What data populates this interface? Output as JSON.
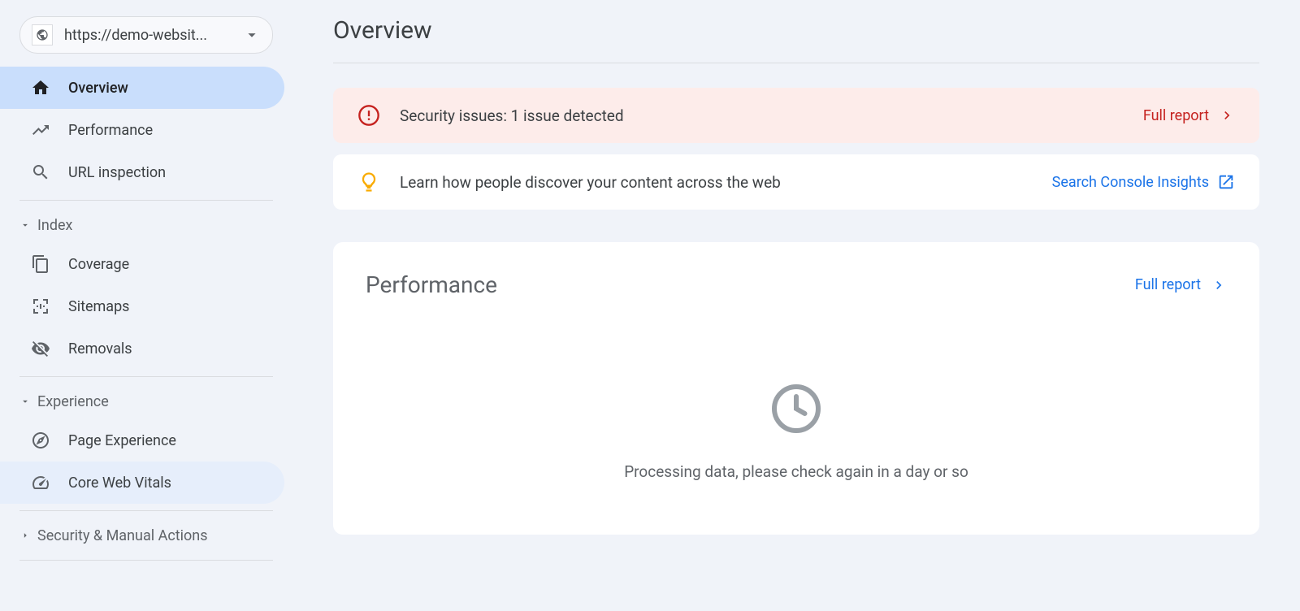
{
  "property": {
    "label": "https://demo-websit..."
  },
  "nav": {
    "overview": "Overview",
    "performance": "Performance",
    "url_inspection": "URL inspection"
  },
  "sections": {
    "index": {
      "title": "Index",
      "items": {
        "coverage": "Coverage",
        "sitemaps": "Sitemaps",
        "removals": "Removals"
      }
    },
    "experience": {
      "title": "Experience",
      "items": {
        "page_experience": "Page Experience",
        "core_web_vitals": "Core Web Vitals"
      }
    },
    "security": {
      "title": "Security & Manual Actions"
    }
  },
  "main": {
    "title": "Overview",
    "security_alert": {
      "text": "Security issues: 1 issue detected",
      "action": "Full report"
    },
    "insights": {
      "text": "Learn how people discover your content across the web",
      "action": "Search Console Insights"
    },
    "performance": {
      "title": "Performance",
      "action": "Full report",
      "empty_message": "Processing data, please check again in a day or so"
    }
  }
}
